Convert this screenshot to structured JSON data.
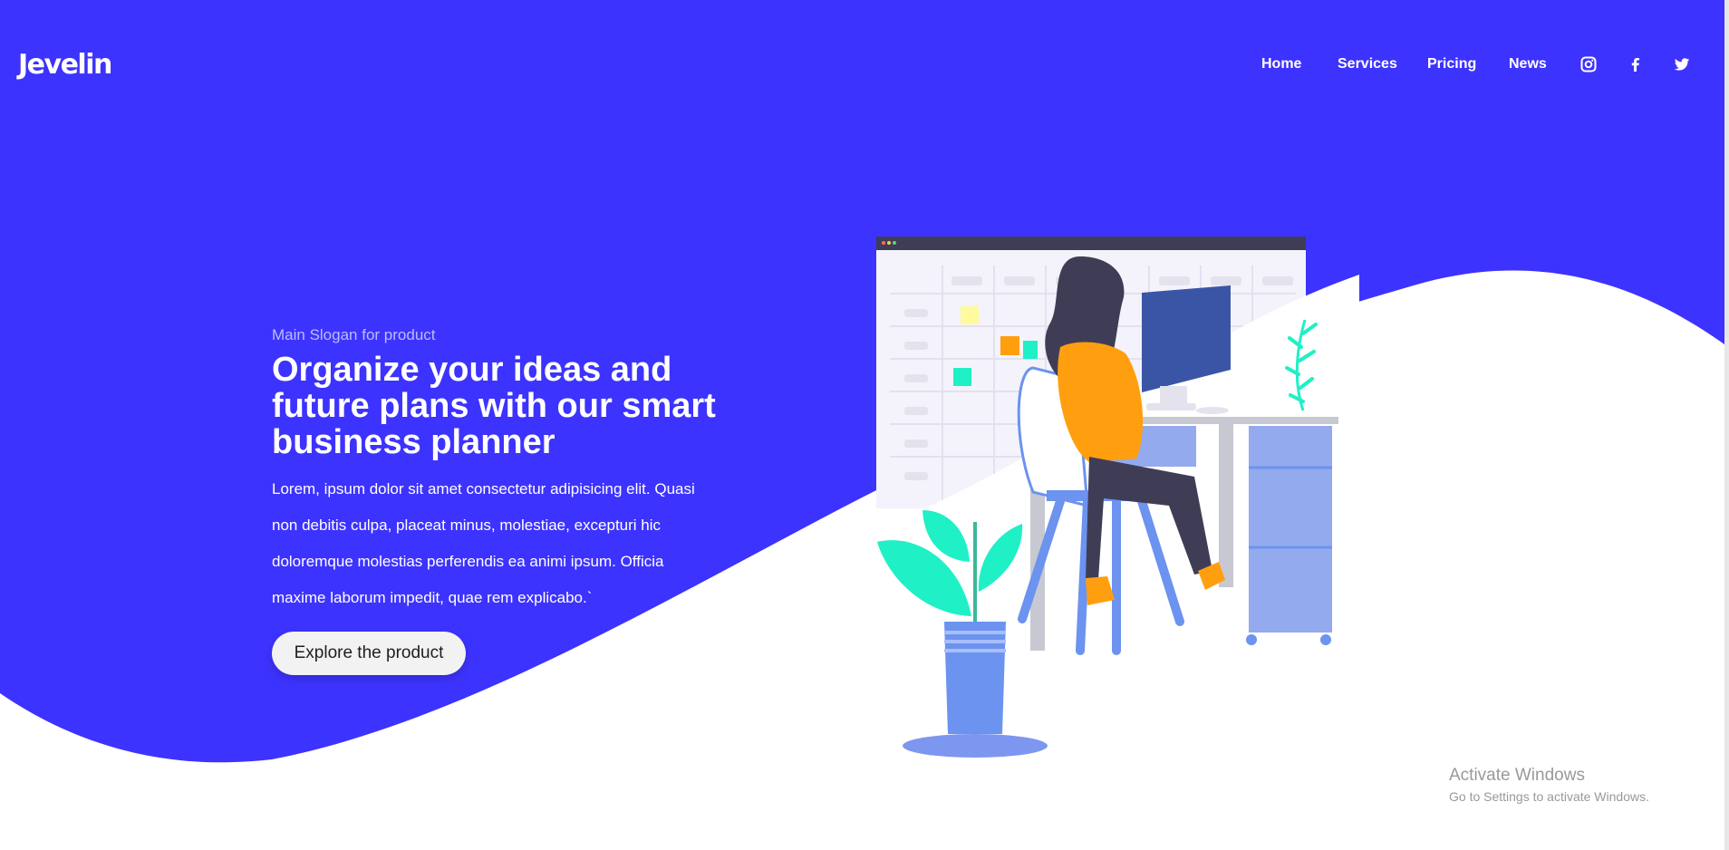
{
  "brand": {
    "logo_text": "Jevelin"
  },
  "nav": {
    "items": [
      {
        "label": "Home"
      },
      {
        "label": "Services"
      },
      {
        "label": "Pricing"
      },
      {
        "label": "News"
      }
    ],
    "social_icons": [
      "instagram-icon",
      "facebook-icon",
      "twitter-icon"
    ]
  },
  "hero": {
    "slogan": "Main Slogan for product",
    "headline": "Organize your ideas and future plans with our smart business planner",
    "description": "Lorem, ipsum dolor sit amet consectetur adipisicing elit. Quasi non debitis culpa, placeat minus, molestiae, excepturi hic doloremque molestias perferendis ea animi ipsum. Officia maxime laborum impedit, quae rem explicabo.`",
    "cta_label": "Explore the product"
  },
  "watermark": {
    "title": "Activate Windows",
    "subtitle": "Go to Settings to activate Windows."
  },
  "colors": {
    "primary": "#3d33fe",
    "white": "#ffffff",
    "accent_orange": "#ff9f0f",
    "accent_teal": "#1ff0c5",
    "desk_blue": "#6b93ef"
  }
}
